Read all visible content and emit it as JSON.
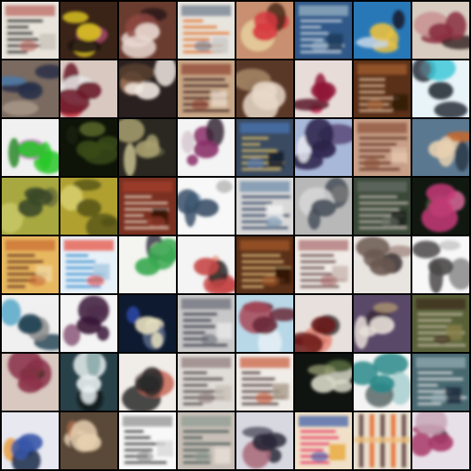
{
  "grid": {
    "rows": 8,
    "cols": 8,
    "background": "#000000",
    "tiles": [
      {
        "style": "doc",
        "bg": "#e8e4dc",
        "c1": "#1c1a1a",
        "c2": "#b8605a",
        "c3": "#c8c2b8"
      },
      {
        "style": "blob",
        "bg": "#3a2418",
        "c1": "#d8c020",
        "c2": "#a84868",
        "c3": "#1a1010"
      },
      {
        "style": "blob",
        "bg": "#6a3c30",
        "c1": "#e8d8d0",
        "c2": "#2a1818",
        "c3": "#904840"
      },
      {
        "style": "doc",
        "bg": "#e8e4de",
        "c1": "#e06818",
        "c2": "#6a7888",
        "c3": "#c8c8c8"
      },
      {
        "style": "blob",
        "bg": "#c89070",
        "c1": "#d83840",
        "c2": "#4a2a1a",
        "c3": "#e8d0a0"
      },
      {
        "style": "doc",
        "bg": "#305888",
        "c1": "#d8e0e8",
        "c2": "#a0b8c8",
        "c3": "#1a3858"
      },
      {
        "style": "blob",
        "bg": "#2878b8",
        "c1": "#e8c040",
        "c2": "#1a1a2a",
        "c3": "#c8d8e8"
      },
      {
        "style": "blob",
        "bg": "#d8ccc0",
        "c1": "#8a3040",
        "c2": "#3a2828",
        "c3": "#c89090"
      },
      {
        "style": "blob",
        "bg": "#7a6a60",
        "c1": "#283048",
        "c2": "#4a78a8",
        "c3": "#a89888"
      },
      {
        "style": "blob",
        "bg": "#d8c8c0",
        "c1": "#6a1828",
        "c2": "#c83040",
        "c3": "#e8e8e8"
      },
      {
        "style": "blob",
        "bg": "#2a2020",
        "c1": "#f0e8e0",
        "c2": "#a8785a",
        "c3": "#584030"
      },
      {
        "style": "doc",
        "bg": "#c8a888",
        "c1": "#3a1818",
        "c2": "#8a4030",
        "c3": "#e8d8c8"
      },
      {
        "style": "blob",
        "bg": "#5a3828",
        "c1": "#e8d8c8",
        "c2": "#3a2018",
        "c3": "#a88868"
      },
      {
        "style": "blob",
        "bg": "#e8dcd8",
        "c1": "#901838",
        "c2": "#c82858",
        "c3": "#5a1828"
      },
      {
        "style": "doc",
        "bg": "#5a3018",
        "c1": "#e8c8a8",
        "c2": "#a86030",
        "c3": "#2a1808"
      },
      {
        "style": "blob",
        "bg": "#e8f4f8",
        "c1": "#283038",
        "c2": "#40c8d8",
        "c3": "#5a6a78"
      },
      {
        "style": "blob",
        "bg": "#f0f0f0",
        "c1": "#28c828",
        "c2": "#d838d8",
        "c3": "#2a8a2a"
      },
      {
        "style": "blob",
        "bg": "#0e1408",
        "c1": "#3a4a18",
        "c2": "#5a6828",
        "c3": "#1a2010"
      },
      {
        "style": "blob",
        "bg": "#2a2820",
        "c1": "#a8a070",
        "c2": "#5a5840",
        "c3": "#c8c090"
      },
      {
        "style": "blob",
        "bg": "#f4f4f4",
        "c1": "#8a3068",
        "c2": "#3a2838",
        "c3": "#d8c8d0"
      },
      {
        "style": "doc",
        "bg": "#3a4a60",
        "c1": "#e8c868",
        "c2": "#4878b8",
        "c3": "#101828"
      },
      {
        "style": "blob",
        "bg": "#a8b8d8",
        "c1": "#2a2048",
        "c2": "#5a4878",
        "c3": "#e8e8f0"
      },
      {
        "style": "doc",
        "bg": "#c8a088",
        "c1": "#5a2818",
        "c2": "#8a5038",
        "c3": "#e8c8b0"
      },
      {
        "style": "blob",
        "bg": "#5a7890",
        "c1": "#e8d0b0",
        "c2": "#c86828",
        "c3": "#2a3848"
      },
      {
        "style": "blob",
        "bg": "#a8a840",
        "c1": "#3a4828",
        "c2": "#c8c868",
        "c3": "#6a7038"
      },
      {
        "style": "blob",
        "bg": "#b0a030",
        "c1": "#5a5818",
        "c2": "#d8d070",
        "c3": "#2a2a10"
      },
      {
        "style": "doc",
        "bg": "#7a3020",
        "c1": "#e8d8c8",
        "c2": "#a84030",
        "c3": "#2a1008"
      },
      {
        "style": "blob",
        "bg": "#f8f8f8",
        "c1": "#3a5068",
        "c2": "#8aa8c8",
        "c3": "#b8b8b8"
      },
      {
        "style": "doc",
        "bg": "#d8d8d8",
        "c1": "#2a3a58",
        "c2": "#6888a8",
        "c3": "#f4f4f4"
      },
      {
        "style": "blob",
        "bg": "#b8b8b8",
        "c1": "#48505a",
        "c2": "#d8d8d8",
        "c3": "#787878"
      },
      {
        "style": "doc",
        "bg": "#3a4838",
        "c1": "#c8c0b8",
        "c2": "#6a7068",
        "c3": "#1a2018"
      },
      {
        "style": "blob",
        "bg": "#101810",
        "c1": "#c83878",
        "c2": "#3a5038",
        "c3": "#d86898"
      },
      {
        "style": "doc",
        "bg": "#e8b860",
        "c1": "#5a2818",
        "c2": "#c86830",
        "c3": "#f0d8a0"
      },
      {
        "style": "doc",
        "bg": "#e8f0f8",
        "c1": "#2888c8",
        "c2": "#e84838",
        "c3": "#a8c8e0"
      },
      {
        "style": "blob",
        "bg": "#f4f4f0",
        "c1": "#38a850",
        "c2": "#3a3a48",
        "c3": "#d8d8c8"
      },
      {
        "style": "blob",
        "bg": "#f4f4f4",
        "c1": "#c84848",
        "c2": "#e89880",
        "c3": "#2a2828"
      },
      {
        "style": "doc",
        "bg": "#5a3018",
        "c1": "#e8c888",
        "c2": "#a85828",
        "c3": "#2a1008"
      },
      {
        "style": "doc",
        "bg": "#f0ebe6",
        "c1": "#5a3838",
        "c2": "#a86868",
        "c3": "#c8b8b0"
      },
      {
        "style": "blob",
        "bg": "#e8e4e0",
        "c1": "#6a5850",
        "c2": "#a89088",
        "c3": "#383030"
      },
      {
        "style": "blob",
        "bg": "#f8f8f8",
        "c1": "#4a4848",
        "c2": "#8a8888",
        "c3": "#c8c8c8"
      },
      {
        "style": "blob",
        "bg": "#f0f0f0",
        "c1": "#284858",
        "c2": "#58a8c8",
        "c3": "#8a8a8a"
      },
      {
        "style": "blob",
        "bg": "#f4f4f4",
        "c1": "#3a1838",
        "c2": "#8a5878",
        "c3": "#c8b8c8"
      },
      {
        "style": "blob",
        "bg": "#0e1a30",
        "c1": "#e8e0c0",
        "c2": "#2848a8",
        "c3": "#5a6a8a"
      },
      {
        "style": "doc",
        "bg": "#c8c8c8",
        "c1": "#2a2a38",
        "c2": "#6a6a78",
        "c3": "#e8e8e8"
      },
      {
        "style": "blob",
        "bg": "#b8d8e8",
        "c1": "#6a2838",
        "c2": "#a84858",
        "c3": "#e8f0f4"
      },
      {
        "style": "blob",
        "bg": "#e8e0dc",
        "c1": "#6a1818",
        "c2": "#e88878",
        "c3": "#3a3838"
      },
      {
        "style": "blob",
        "bg": "#5a4868",
        "c1": "#e8e0d8",
        "c2": "#3a2838",
        "c3": "#a89070"
      },
      {
        "style": "doc",
        "bg": "#586038",
        "c1": "#c8c0a8",
        "c2": "#3a2818",
        "c3": "#88804a"
      },
      {
        "style": "blob",
        "bg": "#d8c8c0",
        "c1": "#8a3048",
        "c2": "#c86878",
        "c3": "#4a3028"
      },
      {
        "style": "blob",
        "bg": "#284048",
        "c1": "#e8f0f0",
        "c2": "#88a8a8",
        "c3": "#101818"
      },
      {
        "style": "blob",
        "bg": "#f0ece8",
        "c1": "#2a2828",
        "c2": "#c86858",
        "c3": "#8a8080"
      },
      {
        "style": "doc",
        "bg": "#e0dcd8",
        "c1": "#3a3030",
        "c2": "#8a7878",
        "c3": "#c8c0b8"
      },
      {
        "style": "doc",
        "bg": "#f0ece8",
        "c1": "#3a2828",
        "c2": "#c85838",
        "c3": "#a89888"
      },
      {
        "style": "blob",
        "bg": "#101410",
        "c1": "#d8d8c8",
        "c2": "#3a5028",
        "c3": "#8a9068"
      },
      {
        "style": "blob",
        "bg": "#f4f4f4",
        "c1": "#288888",
        "c2": "#a8d0d0",
        "c3": "#5a6868"
      },
      {
        "style": "doc",
        "bg": "#486870",
        "c1": "#e8e8e8",
        "c2": "#98b0b8",
        "c3": "#182838"
      },
      {
        "style": "blob",
        "bg": "#e8e8f0",
        "c1": "#3858a8",
        "c2": "#e8a040",
        "c3": "#1a2848"
      },
      {
        "style": "blob",
        "bg": "#5a4838",
        "c1": "#e8d0b0",
        "c2": "#a86848",
        "c3": "#2a2018"
      },
      {
        "style": "doc",
        "bg": "#f8f8f8",
        "c1": "#2a2a2a",
        "c2": "#8a8a8a",
        "c3": "#d8d8d8"
      },
      {
        "style": "doc",
        "bg": "#c8c0b8",
        "c1": "#3a4a48",
        "c2": "#8a9890",
        "c3": "#e8e0d8"
      },
      {
        "style": "blob",
        "bg": "#d8d8e0",
        "c1": "#2a2838",
        "c2": "#a86878",
        "c3": "#5a5868"
      },
      {
        "style": "doc",
        "bg": "#f0e0c8",
        "c1": "#e82858",
        "c2": "#3858a8",
        "c3": "#e8a838"
      },
      {
        "style": "stripes",
        "bg": "#e8e0d0",
        "c1": "#e86020",
        "c2": "#5a3838",
        "c3": "#f0c080"
      },
      {
        "style": "blob",
        "bg": "#e8e0e8",
        "c1": "#a83868",
        "c2": "#3a2838",
        "c3": "#c8a8b8"
      }
    ]
  }
}
